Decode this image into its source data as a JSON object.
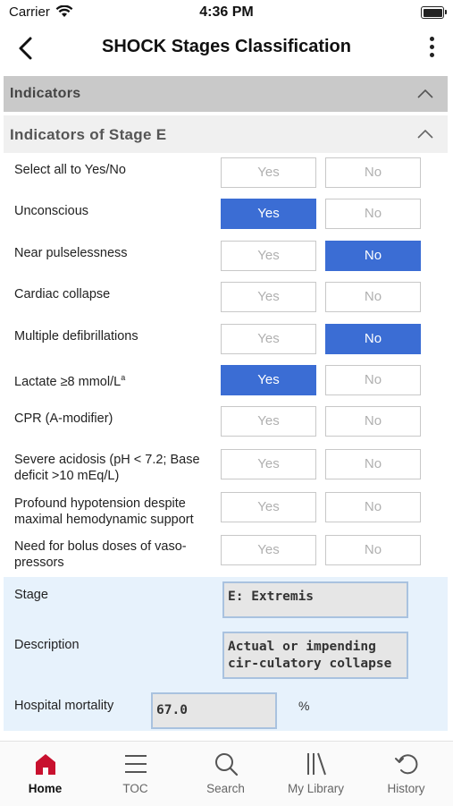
{
  "status_bar": {
    "carrier": "Carrier",
    "time": "4:36 PM"
  },
  "nav": {
    "title": "SHOCK Stages Classification"
  },
  "indicators_header": "Indicators",
  "stage_header": "Indicators of Stage E",
  "rows": [
    {
      "label": "Select all to Yes/No",
      "yes": "Yes",
      "no": "No",
      "selected": "none"
    },
    {
      "label": "Unconscious",
      "yes": "Yes",
      "no": "No",
      "selected": "yes"
    },
    {
      "label": "Near pulselessness",
      "yes": "Yes",
      "no": "No",
      "selected": "no"
    },
    {
      "label": "Cardiac collapse",
      "yes": "Yes",
      "no": "No",
      "selected": "none"
    },
    {
      "label": "Multiple defibrillations",
      "yes": "Yes",
      "no": "No",
      "selected": "no"
    },
    {
      "label": "Lactate ≥8 mmol/L",
      "label_sup": "a",
      "yes": "Yes",
      "no": "No",
      "selected": "yes"
    },
    {
      "label": "CPR (A-modifier)",
      "yes": "Yes",
      "no": "No",
      "selected": "none"
    },
    {
      "label": "Severe acidosis (pH < 7.2; Base deficit >10 mEq/L)",
      "yes": "Yes",
      "no": "No",
      "selected": "none"
    },
    {
      "label": "Profound hypotension despite maximal hemodynamic support",
      "yes": "Yes",
      "no": "No",
      "selected": "none"
    },
    {
      "label": "Need for bolus doses of vaso-pressors",
      "yes": "Yes",
      "no": "No",
      "selected": "none"
    }
  ],
  "results": {
    "stage_label": "Stage",
    "stage_value": "E: Extremis",
    "description_label": "Description",
    "description_value": "Actual or impending cir-culatory collapse",
    "mortality_label": "Hospital mortality",
    "mortality_value": "67.0",
    "mortality_unit": "%"
  },
  "tabs": [
    {
      "label": "Home",
      "icon": "home-icon",
      "active": true
    },
    {
      "label": "TOC",
      "icon": "menu-icon",
      "active": false
    },
    {
      "label": "Search",
      "icon": "search-icon",
      "active": false
    },
    {
      "label": "My Library",
      "icon": "library-icon",
      "active": false
    },
    {
      "label": "History",
      "icon": "history-icon",
      "active": false
    }
  ],
  "colors": {
    "accent": "#3b6dd4",
    "home_icon": "#c8102e",
    "result_bg": "#e7f2fc"
  }
}
